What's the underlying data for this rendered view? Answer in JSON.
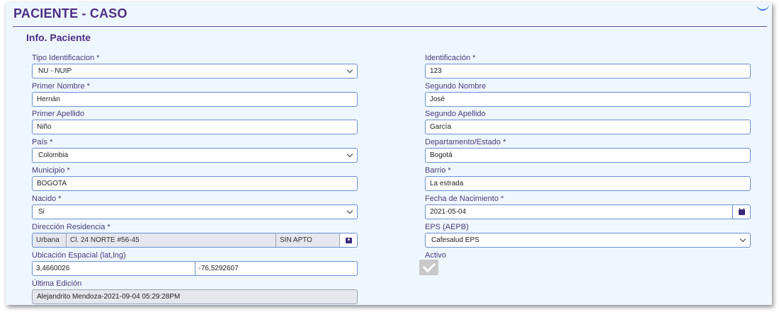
{
  "header": {
    "title": "PACIENTE - CASO"
  },
  "section": {
    "title": "Info. Paciente"
  },
  "fields": {
    "tipo_identificacion": {
      "label": "Tipo Identificacion *",
      "value": "NU - NUIP"
    },
    "identificacion": {
      "label": "Identificación *",
      "value": "123"
    },
    "primer_nombre": {
      "label": "Primer Nombre *",
      "value": "Hernán"
    },
    "segundo_nombre": {
      "label": "Segundo Nombre",
      "value": "José"
    },
    "primer_apellido": {
      "label": "Primer Apellido",
      "value": "Niño"
    },
    "segundo_apellido": {
      "label": "Segundo Apellido",
      "value": "García"
    },
    "pais": {
      "label": "País *",
      "value": "Colombia"
    },
    "departamento": {
      "label": "Departamento/Estado *",
      "value": "Bogotá"
    },
    "municipio": {
      "label": "Municipio *",
      "value": "BOGOTA"
    },
    "barrio": {
      "label": "Barrio *",
      "value": "La estrada"
    },
    "nacido": {
      "label": "Nacido *",
      "value": "Si"
    },
    "fecha_nacimiento": {
      "label": "Fecha de Nacimiento *",
      "value": "2021-05-04"
    },
    "direccion": {
      "label": "Dirección Residencia *",
      "zona": "Urbana",
      "calle": "Cl. 24 NORTE #56-45",
      "apto": "SIN APTO"
    },
    "eps": {
      "label": "EPS (AEPB)",
      "value": "Cafesalud EPS"
    },
    "ubicacion": {
      "label": "Ubicación Espacial (lat,lng)",
      "lat": "3,4660026",
      "lng": "-76,5292607"
    },
    "activo": {
      "label": "Activo",
      "checked": true
    },
    "ultima_edicion": {
      "label": "Última Edición",
      "value": "Alejandrito Mendoza-2021-09-04 05:29:28PM"
    }
  },
  "icons": {
    "chevron": "chevron-down-icon",
    "calendar": "calendar-icon",
    "address_card": "address-card-icon",
    "check": "check-icon",
    "refresh": "refresh-icon"
  },
  "colors": {
    "accent": "#4b2e83",
    "border": "#6b8fd6",
    "panel_bg": "#eef6ff"
  }
}
